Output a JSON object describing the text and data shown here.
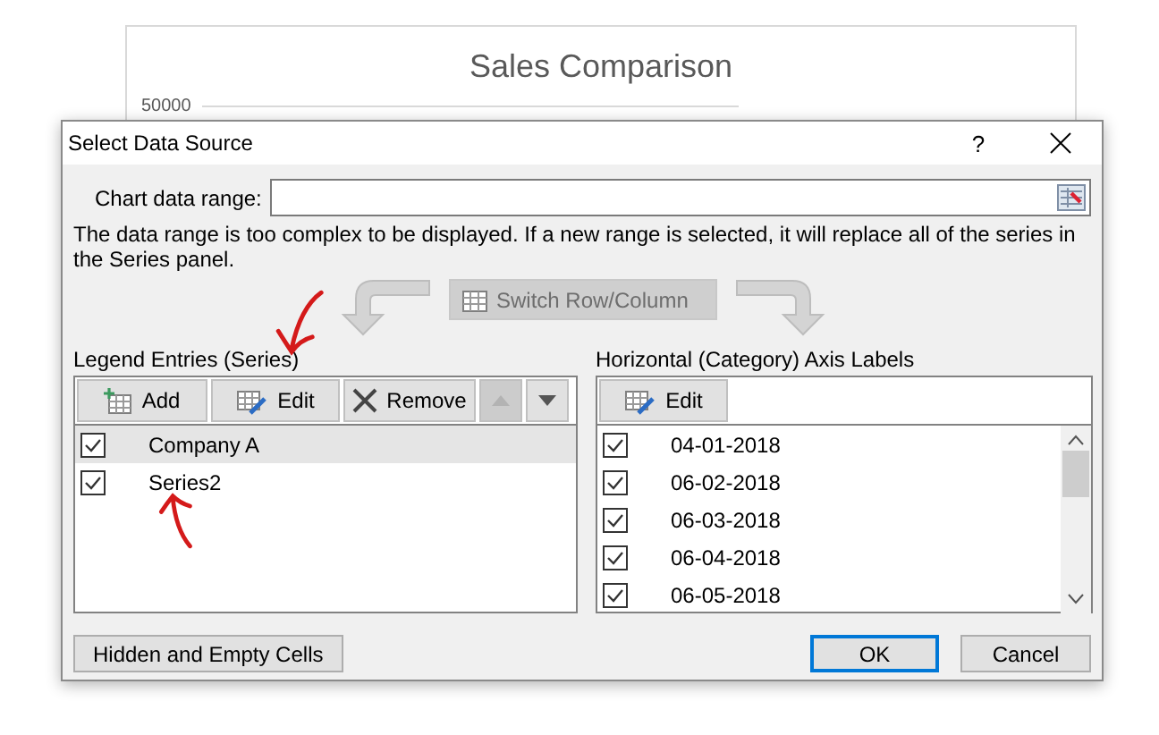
{
  "chart": {
    "title": "Sales Comparison",
    "y_tick": "50000"
  },
  "dialog": {
    "title": "Select Data Source",
    "help": "?",
    "range": {
      "label": "Chart data range:"
    },
    "message": "The data range is too complex to be displayed. If a new range is selected, it will replace all of the series in the Series panel.",
    "switch_button": {
      "label": "Switch Row/Column",
      "disabled": true
    },
    "legend": {
      "heading": "Legend Entries (Series)",
      "buttons": [
        {
          "label": "Add",
          "kind": "add"
        },
        {
          "label": "Edit",
          "kind": "edit"
        },
        {
          "label": "Remove",
          "kind": "remove"
        }
      ],
      "move_up": {
        "disabled": true
      },
      "move_down": {
        "disabled": false
      },
      "entries": [
        {
          "name": "Company A",
          "checked": true,
          "selected": true
        },
        {
          "name": "Series2",
          "checked": true,
          "selected": false
        }
      ]
    },
    "axis": {
      "heading": "Horizontal (Category) Axis Labels",
      "edit_button": "Edit",
      "labels": [
        {
          "text": "04-01-2018",
          "checked": true
        },
        {
          "text": "06-02-2018",
          "checked": true
        },
        {
          "text": "06-03-2018",
          "checked": true
        },
        {
          "text": "06-04-2018",
          "checked": true
        },
        {
          "text": "06-05-2018",
          "checked": true
        }
      ]
    },
    "hidden_button": "Hidden and Empty Cells",
    "ok_button": "OK",
    "cancel_button": "Cancel"
  }
}
